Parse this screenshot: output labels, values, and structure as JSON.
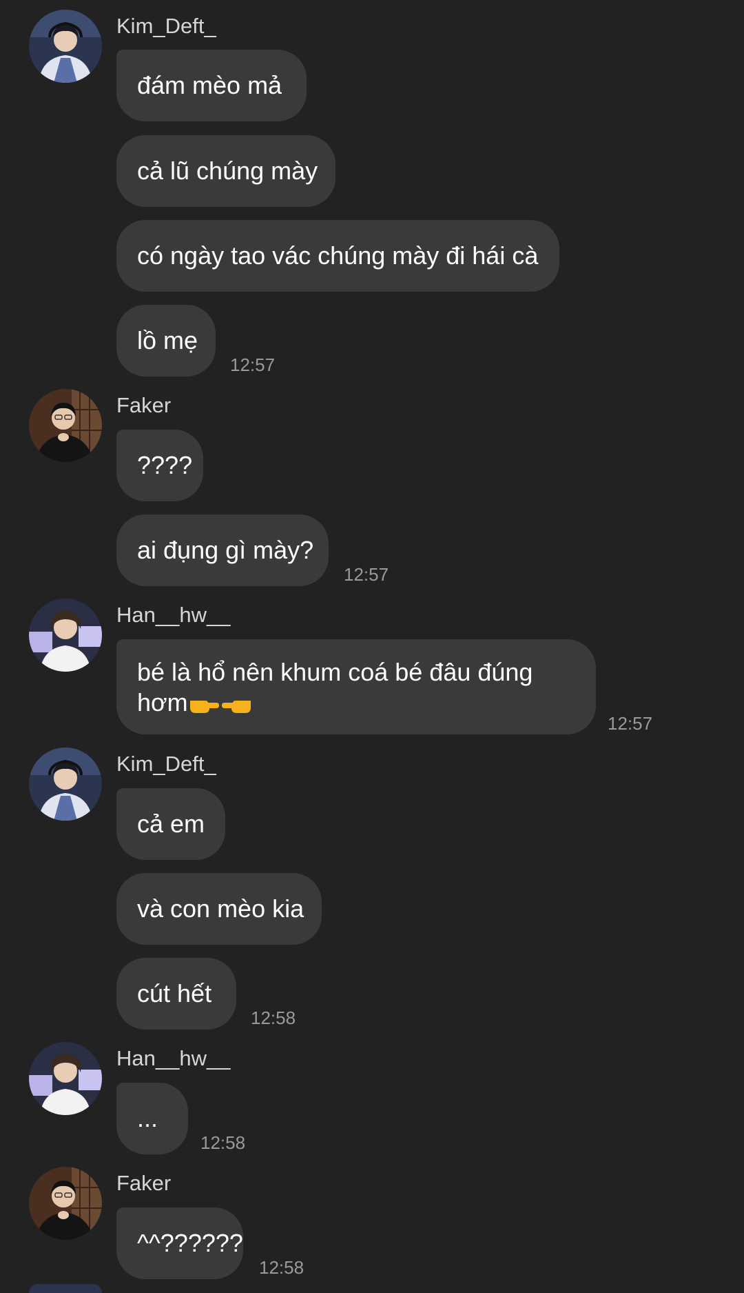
{
  "users": {
    "kim": "Kim_Deft_",
    "faker": "Faker",
    "han": "Han__hw__"
  },
  "messages": [
    {
      "text": "đám mèo mả"
    },
    {
      "text": "cả lũ chúng mày"
    },
    {
      "text": "có ngày tao vác chúng mày đi hái cà"
    },
    {
      "text": "lồ mẹ",
      "time": "12:57"
    },
    {
      "text": "????"
    },
    {
      "text": "ai đụng gì mày?",
      "time": "12:57"
    },
    {
      "text": "bé là hổ nên khum coá bé đâu đúng hơm",
      "emoji": "👉👈",
      "time": "12:57"
    },
    {
      "text": "cả em"
    },
    {
      "text": "và con mèo kia"
    },
    {
      "text": "cút hết",
      "time": "12:58"
    },
    {
      "text": "...",
      "time": "12:58"
    },
    {
      "text": "^^??????",
      "time": "12:58"
    }
  ],
  "colors": {
    "background": "#222222",
    "bubble": "#3a3a3a",
    "text": "#ffffff",
    "sender": "#d6d6d6",
    "time": "#9a9a9a"
  }
}
